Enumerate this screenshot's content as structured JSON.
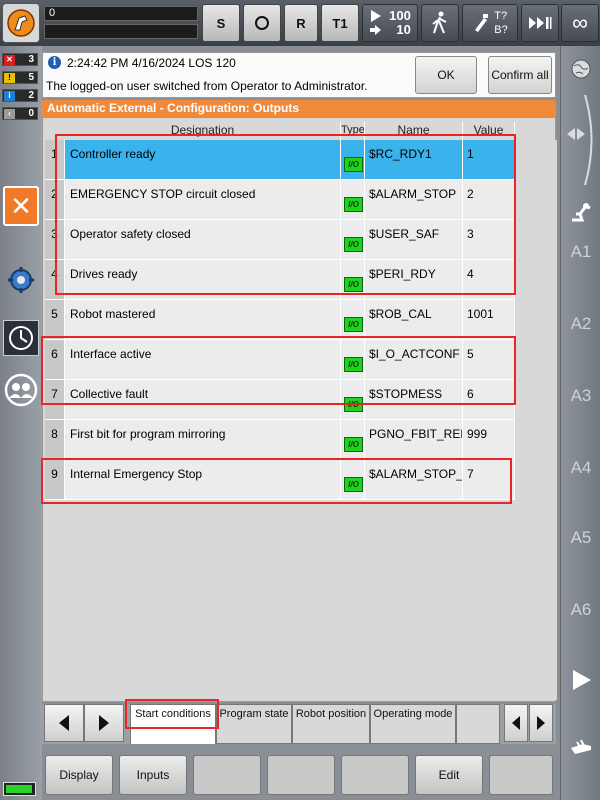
{
  "status_bar": {
    "program_field": "0",
    "buttons": [
      "S",
      "O",
      "R",
      "T1"
    ],
    "override_top": "100",
    "override_bottom": "10",
    "tool_label_top": "T?",
    "tool_label_bottom": "B?",
    "infinity": "∞"
  },
  "message_counts": [
    {
      "icon": "error-icon",
      "count": "3",
      "color": "#d82020"
    },
    {
      "icon": "warning-icon",
      "count": "5",
      "color": "#e8c000"
    },
    {
      "icon": "info-icon",
      "count": "2",
      "color": "#1e7fd4"
    },
    {
      "icon": "wait-icon",
      "count": "0",
      "color": "#9a9a9a"
    }
  ],
  "message": {
    "time": "2:24:42 PM 4/16/2024 LOS 120",
    "text": "The logged-on user switched from Operator to Administrator.",
    "ok_label": "OK",
    "confirm_all_label": "Confirm all"
  },
  "window_title": "Automatic External - Configuration: Outputs",
  "table": {
    "headers": {
      "designation": "Designation",
      "type": "Type",
      "name": "Name",
      "value": "Value"
    },
    "io_label": "I/O",
    "rows": [
      {
        "num": "1",
        "designation": "Controller ready",
        "name": "$RC_RDY1",
        "value": "1"
      },
      {
        "num": "2",
        "designation": "EMERGENCY STOP circuit closed",
        "name": "$ALARM_STOP",
        "value": "2"
      },
      {
        "num": "3",
        "designation": "Operator safety closed",
        "name": "$USER_SAF",
        "value": "3"
      },
      {
        "num": "4",
        "designation": "Drives ready",
        "name": "$PERI_RDY",
        "value": "4"
      },
      {
        "num": "5",
        "designation": "Robot mastered",
        "name": "$ROB_CAL",
        "value": "1001"
      },
      {
        "num": "6",
        "designation": "Interface active",
        "name": "$I_O_ACTCONF",
        "value": "5"
      },
      {
        "num": "7",
        "designation": "Collective fault",
        "name": "$STOPMESS",
        "value": "6"
      },
      {
        "num": "8",
        "designation": "First bit for program mirroring",
        "name": "PGNO_FBIT_REFL",
        "value": "999"
      },
      {
        "num": "9",
        "designation": "Internal Emergency Stop",
        "name": "$ALARM_STOP_I",
        "value": "7"
      }
    ]
  },
  "tabs": [
    "Start conditions",
    "Program state",
    "Robot position",
    "Operating mode"
  ],
  "softkeys": [
    "Display",
    "Inputs",
    "",
    "",
    "",
    "Edit",
    ""
  ],
  "axes": [
    "A1",
    "A2",
    "A3",
    "A4",
    "A5",
    "A6"
  ],
  "colors": {
    "accent": "#f08a3a",
    "selected_row": "#3ab2ec",
    "io_badge": "#1ed21e",
    "highlight_box": "#e8262a"
  }
}
